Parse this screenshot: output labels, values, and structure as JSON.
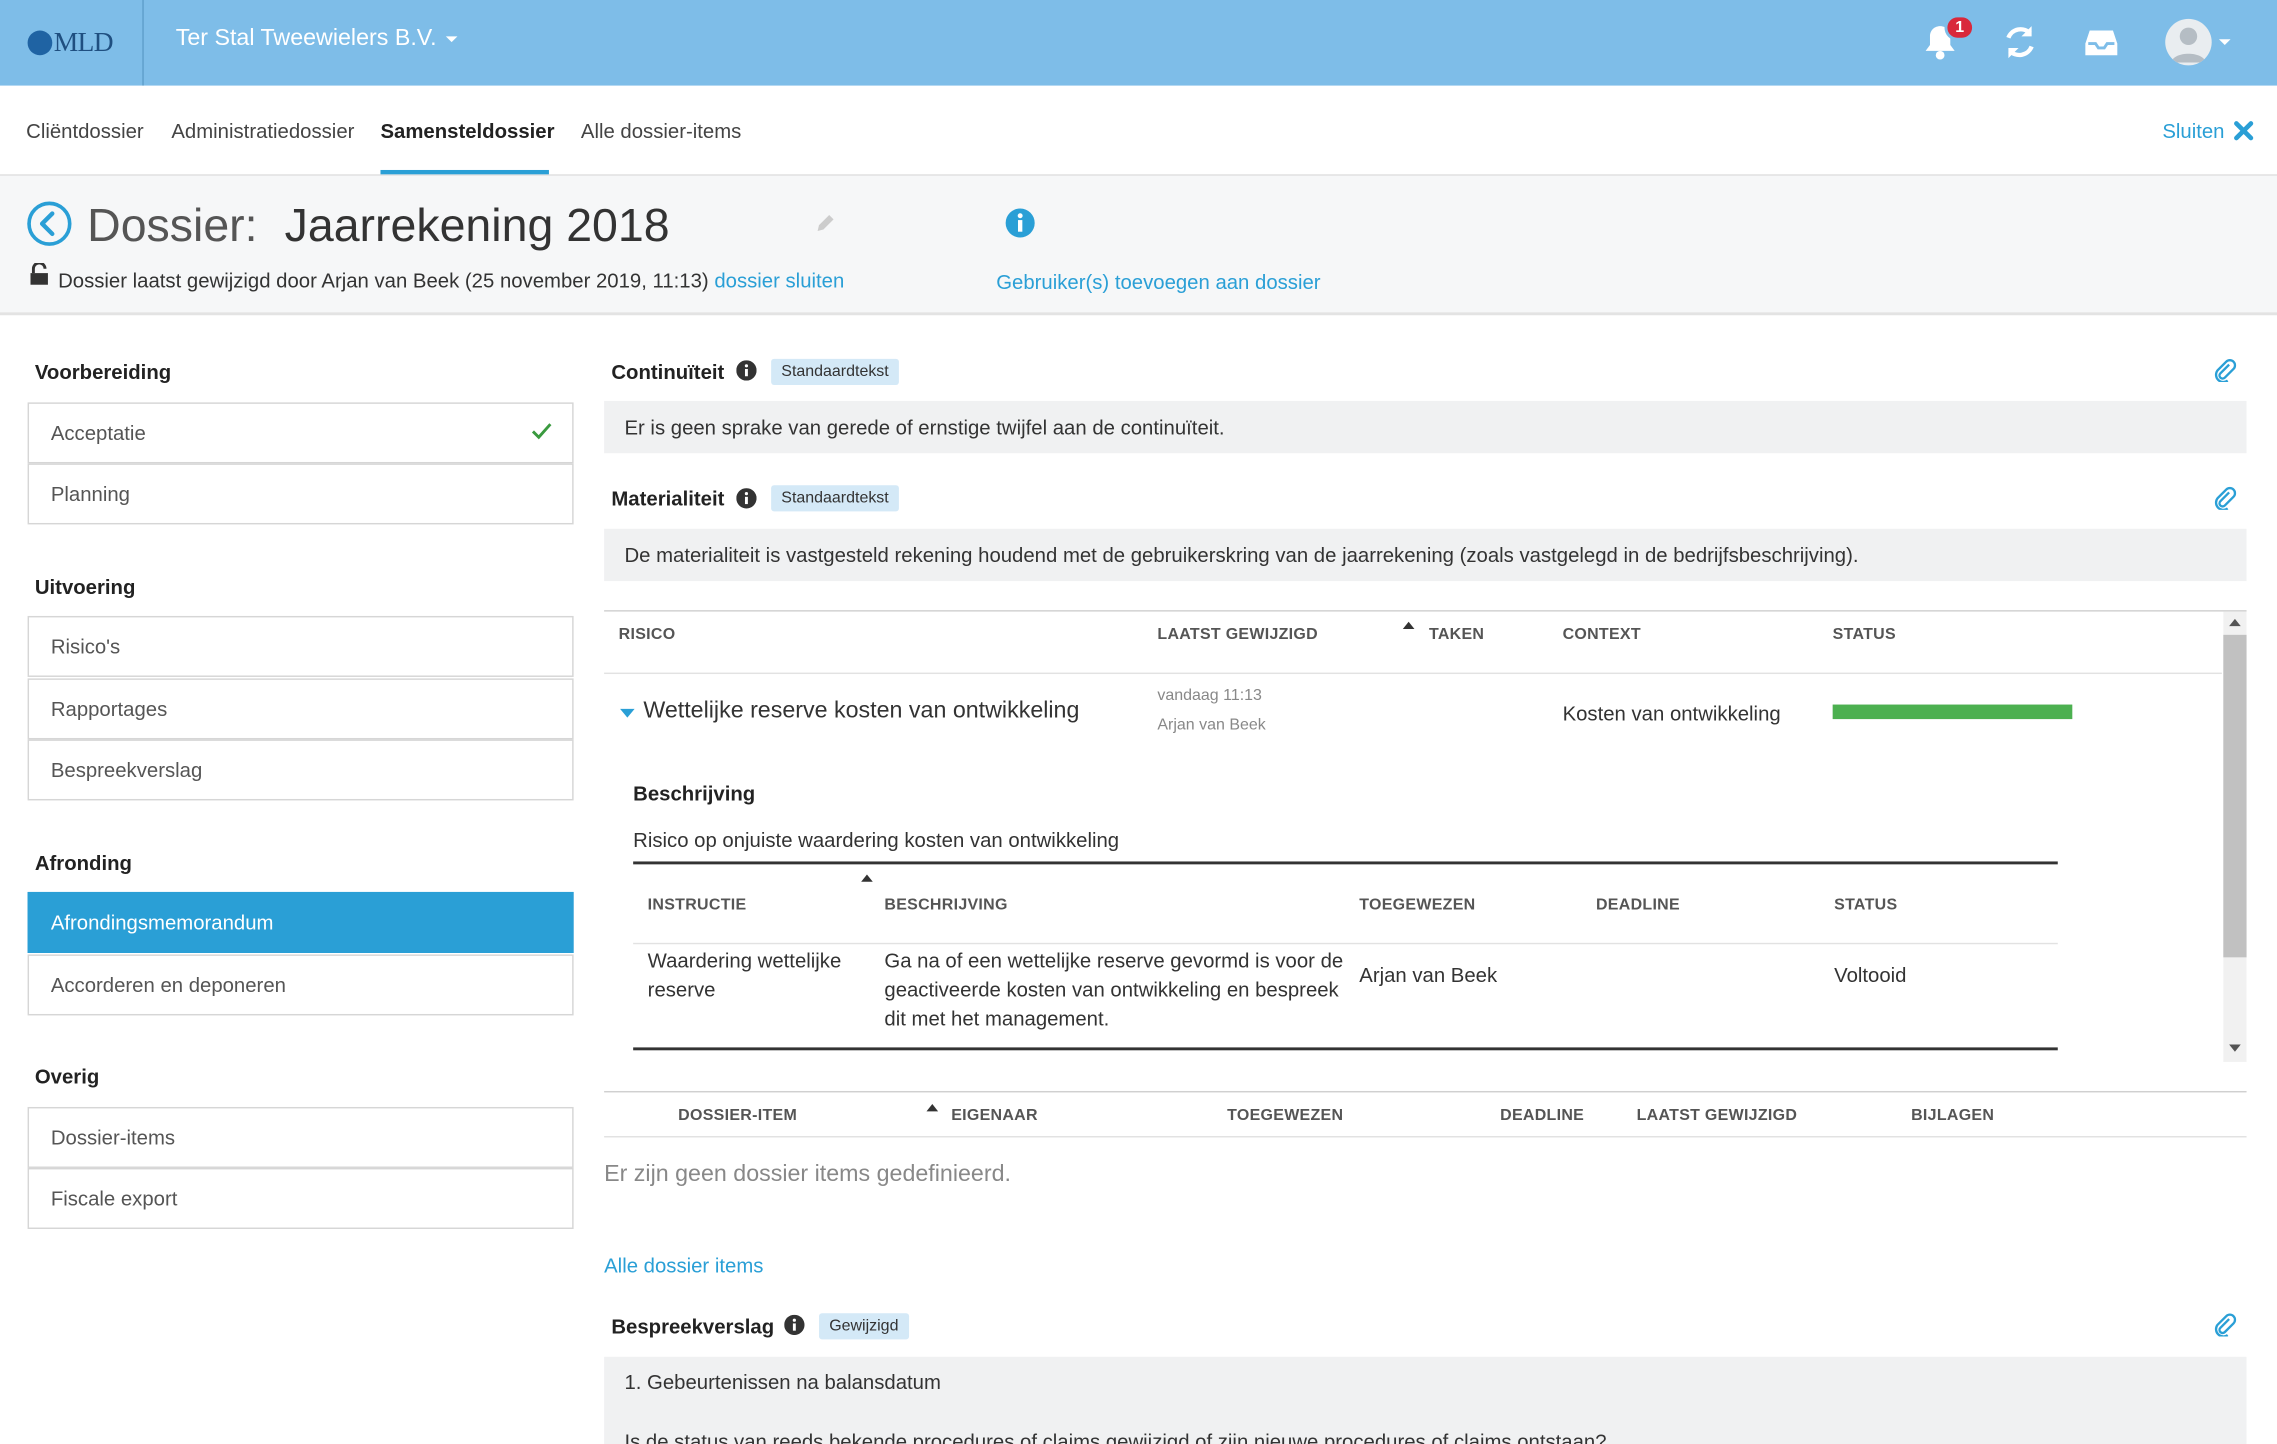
{
  "app": {
    "logo_text": "MLD",
    "company": "Ter Stal Tweewielers B.V.",
    "notification_count": "1"
  },
  "tabs": [
    {
      "label": "Cliëntdossier"
    },
    {
      "label": "Administratiedossier"
    },
    {
      "label": "Samensteldossier",
      "active": true
    },
    {
      "label": "Alle dossier-items"
    }
  ],
  "close_label": "Sluiten",
  "dossier": {
    "label": "Dossier:",
    "title": "Jaarrekening 2018",
    "meta": "Dossier laatst gewijzigd door Arjan van Beek (25 november 2019, 11:13)",
    "close_link": "dossier sluiten",
    "add_users": "Gebruiker(s) toevoegen aan dossier"
  },
  "sidebar": {
    "sections": [
      {
        "title": "Voorbereiding",
        "items": [
          "Acceptatie",
          "Planning"
        ]
      },
      {
        "title": "Uitvoering",
        "items": [
          "Risico's",
          "Rapportages",
          "Bespreekverslag"
        ]
      },
      {
        "title": "Afronding",
        "items": [
          "Afrondingsmemorandum",
          "Accorderen en deponeren"
        ]
      },
      {
        "title": "Overig",
        "items": [
          "Dossier-items",
          "Fiscale export"
        ]
      }
    ],
    "active_item": "Afrondingsmemorandum",
    "checked_item": "Acceptatie"
  },
  "sections": {
    "continuiteit": {
      "title": "Continuïteit",
      "tag": "Standaardtekst",
      "text": "Er is geen sprake van gerede of  ernstige twijfel aan de continuïteit."
    },
    "materialiteit": {
      "title": "Materialiteit",
      "tag": "Standaardtekst",
      "text": "De materialiteit is vastgesteld rekening houdend met de gebruikerskring van de jaarrekening (zoals vastgelegd in de bedrijfsbeschrijving)."
    },
    "bespreekverslag": {
      "title": "Bespreekverslag",
      "tag": "Gewijzigd",
      "line1": "1. Gebeurtenissen na balansdatum",
      "line2": "Is de status van reeds bekende procedures of claims gewijzigd of zijn nieuwe procedures of claims ontstaan?"
    }
  },
  "risk_table": {
    "headers": [
      "RISICO",
      "LAATST GEWIJZIGD",
      "TAKEN",
      "CONTEXT",
      "STATUS"
    ],
    "row": {
      "name": "Wettelijke reserve kosten van ontwikkeling",
      "modified_date": "vandaag 11:13",
      "modified_by": "Arjan van Beek",
      "context": "Kosten van ontwikkeling",
      "status_progress": 1.0,
      "status_color": "#4cb050"
    },
    "description_title": "Beschrijving",
    "description_text": "Risico op onjuiste waardering kosten van ontwikkeling",
    "inner_headers": [
      "INSTRUCTIE",
      "BESCHRIJVING",
      "TOEGEWEZEN",
      "DEADLINE",
      "STATUS"
    ],
    "inner_row": {
      "instructie": "Waardering wettelijke reserve",
      "beschrijving": "Ga na of een wettelijke reserve gevormd is voor de geactiveerde kosten van ontwikkeling en bespreek dit met het management.",
      "toegewezen": "Arjan van Beek",
      "deadline": "",
      "status": "Voltooid"
    }
  },
  "dossier_items": {
    "headers": [
      "DOSSIER-ITEM",
      "EIGENAAR",
      "TOEGEWEZEN",
      "DEADLINE",
      "LAATST GEWIJZIGD",
      "BIJLAGEN"
    ],
    "empty_message": "Er zijn geen dossier items gedefinieerd.",
    "all_link": "Alle dossier items"
  },
  "colors": {
    "topbar": "#7ebde8",
    "accent": "#2a9fd6",
    "status_green": "#4cb050",
    "badge_red": "#d9283b"
  }
}
